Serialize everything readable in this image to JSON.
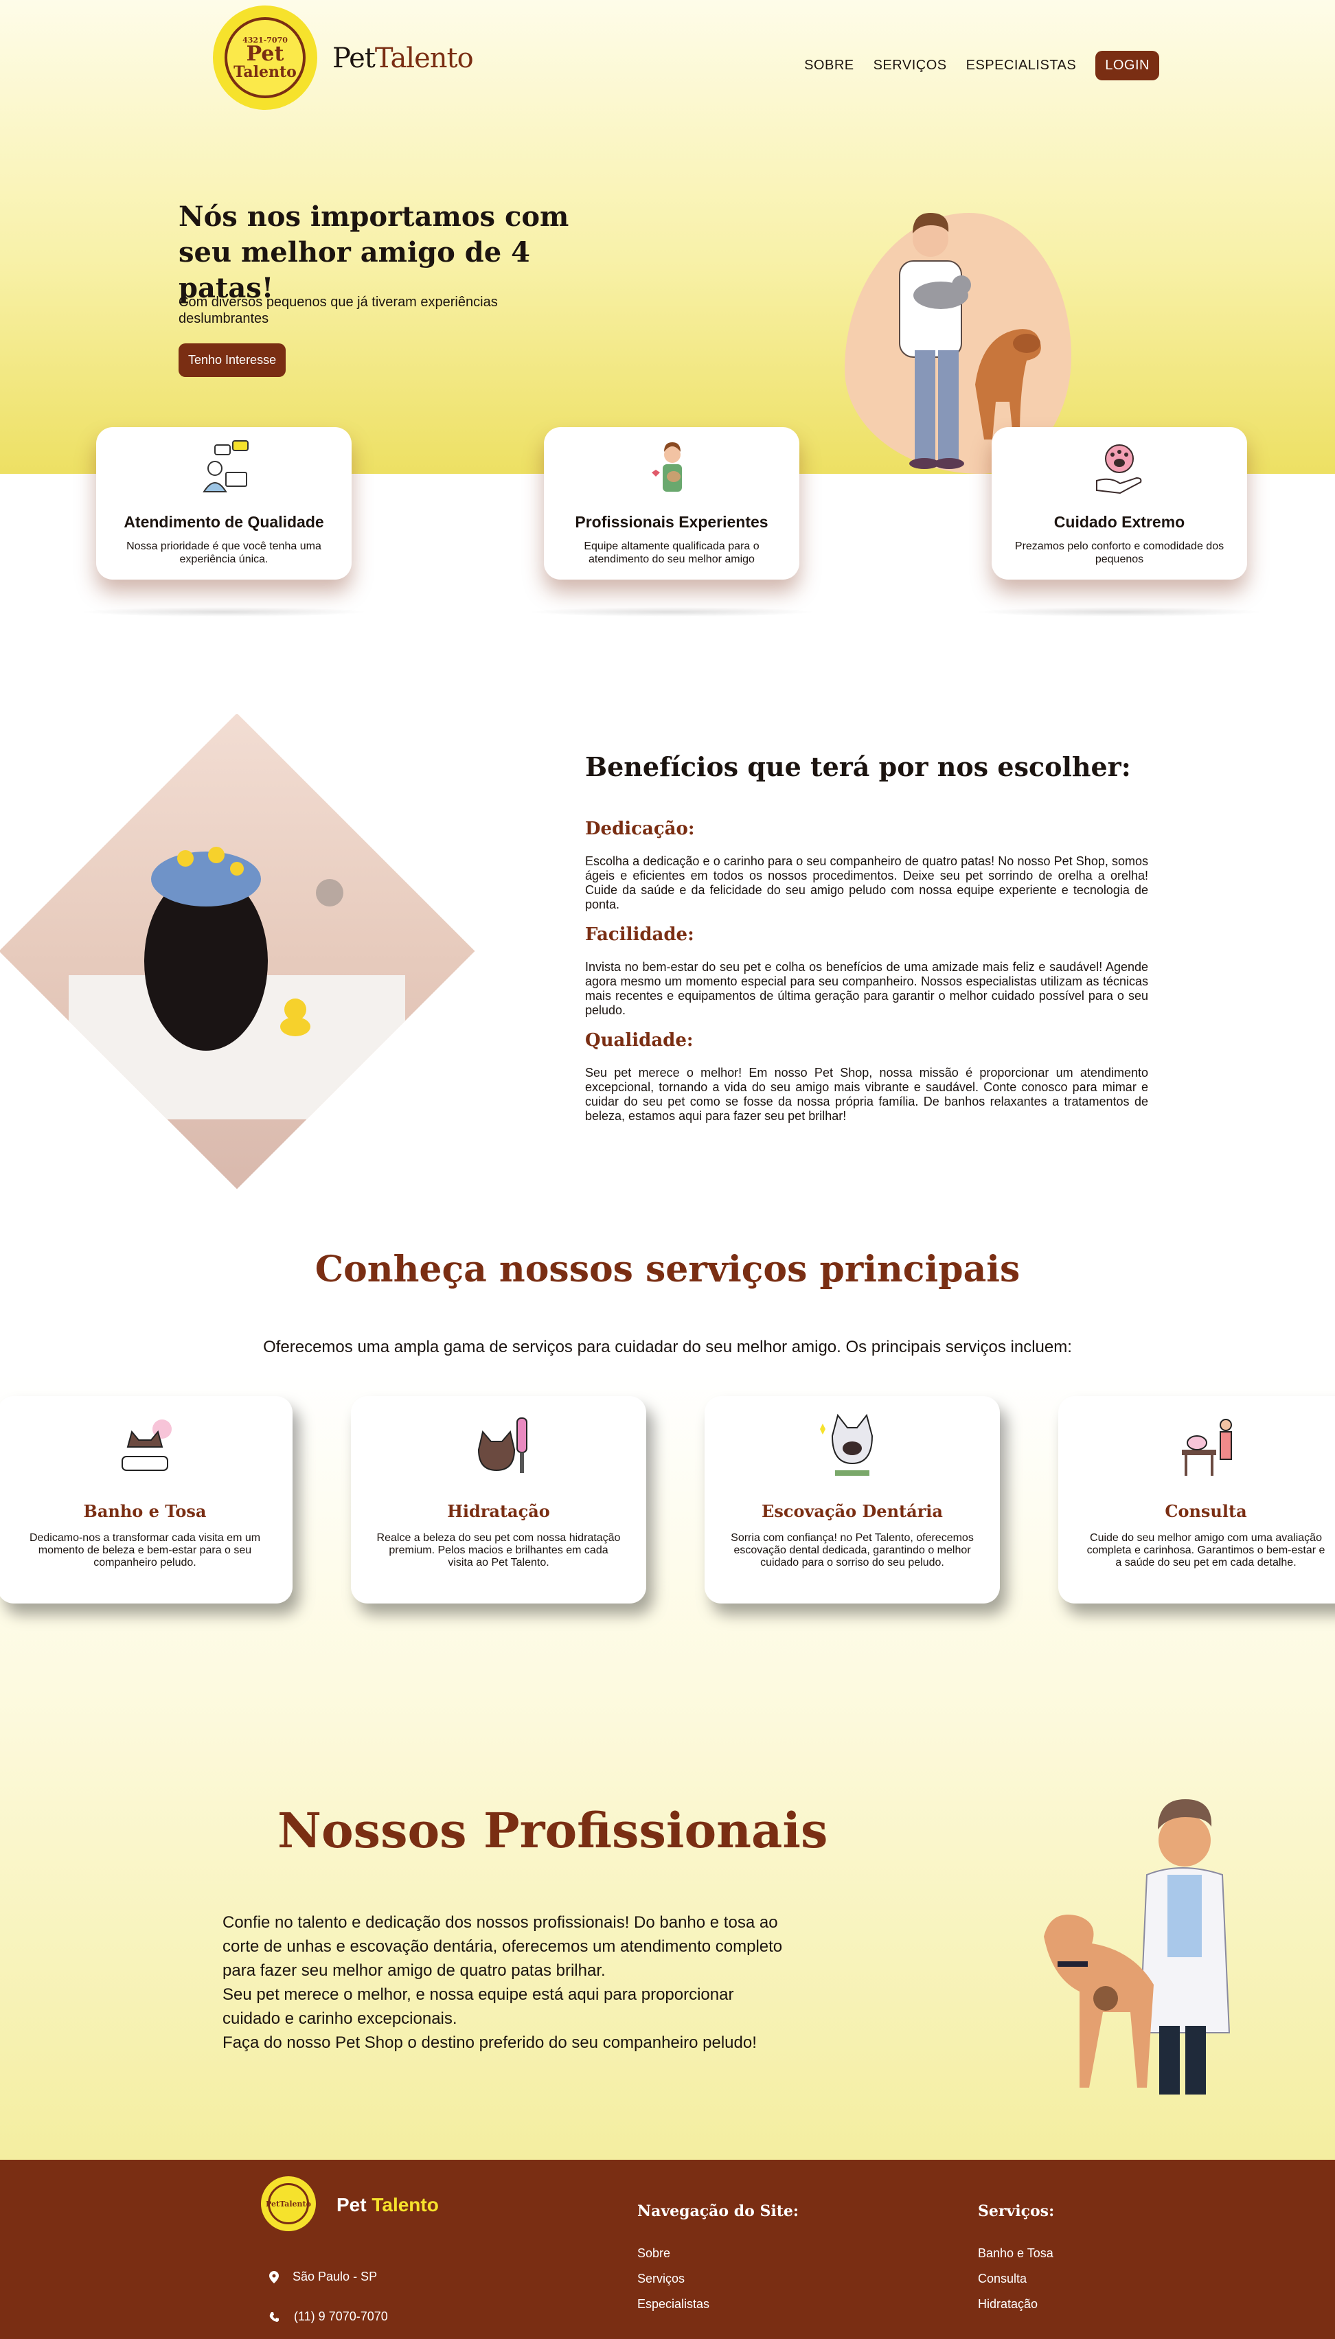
{
  "header": {
    "logo_text": [
      "4321-7070",
      "Pet",
      "Talento"
    ],
    "brand_part1": "Pet",
    "brand_part2": "Talento",
    "nav": [
      "SOBRE",
      "SERVIÇOS",
      "ESPECIALISTAS"
    ],
    "login": "LOGIN"
  },
  "hero": {
    "title": "Nós nos importamos com seu melhor amigo de 4 patas!",
    "subtitle": "Com diversos pequenos que já tiveram experiências deslumbrantes",
    "button": "Tenho Interesse"
  },
  "features": [
    {
      "title": "Atendimento de Qualidade",
      "text": "Nossa prioridade é que você tenha uma experiência única.",
      "icon": "support-agent-icon"
    },
    {
      "title": "Profissionais Experientes",
      "text": "Equipe altamente qualificada para o atendimento do seu melhor amigo",
      "icon": "pet-caretaker-icon"
    },
    {
      "title": "Cuidado Extremo",
      "text": "Prezamos pelo conforto e comodidade dos pequenos",
      "icon": "paw-hand-icon"
    }
  ],
  "benefits": {
    "title": "Benefícios que terá por nos escolher:",
    "items": [
      {
        "heading": "Dedicação:",
        "text": "Escolha a dedicação e o carinho para o seu companheiro de quatro patas! No nosso Pet Shop, somos ágeis e eficientes em todos os nossos procedimentos. Deixe seu pet sorrindo de orelha a orelha! Cuide da saúde e da felicidade do seu amigo peludo com nossa equipe experiente e tecnologia de ponta."
      },
      {
        "heading": "Facilidade:",
        "text": "Invista no bem-estar do seu pet e colha os benefícios de uma amizade mais feliz e saudável! Agende agora mesmo um momento especial para seu companheiro. Nossos especialistas utilizam as técnicas mais recentes e equipamentos de última geração para garantir o melhor cuidado possível para o seu peludo."
      },
      {
        "heading": "Qualidade:",
        "text": "Seu pet merece o melhor! Em nosso Pet Shop, nossa missão é proporcionar um atendimento excepcional, tornando a vida do seu amigo mais vibrante e saudável. Conte conosco para mimar e cuidar do seu pet como se fosse da nossa própria família. De banhos relaxantes a tratamentos de beleza, estamos aqui para fazer seu pet brilhar!"
      }
    ]
  },
  "services": {
    "title": "Conheça nossos serviços principais",
    "subtitle": "Oferecemos uma ampla gama de serviços para cuidadar do seu melhor amigo. Os principais serviços incluem:",
    "cards": [
      {
        "title": "Banho e Tosa",
        "text": "Dedicamo-nos a transformar cada visita em um momento de beleza e bem-estar para o seu companheiro peludo."
      },
      {
        "title": "Hidratação",
        "text": "Realce a beleza do seu pet com nossa hidratação premium. Pelos macios e brilhantes em cada visita ao Pet Talento."
      },
      {
        "title": "Escovação Dentária",
        "text": "Sorria com confiança! no Pet Talento, oferecemos escovação dental dedicada, garantindo o melhor cuidado para o sorriso do seu peludo."
      },
      {
        "title": "Consulta",
        "text": "Cuide do seu melhor amigo com uma avaliação completa e carinhosa. Garantimos o bem-estar e a saúde do seu pet em cada detalhe."
      }
    ]
  },
  "professionals": {
    "title": "Nossos Profissionais",
    "lines": [
      "Confie no talento e dedicação dos nossos profissionais! Do banho e tosa ao corte de unhas e escovação dentária, oferecemos um atendimento completo para fazer seu melhor amigo de quatro patas brilhar.",
      "Seu pet merece o melhor, e nossa equipe está aqui para proporcionar cuidado e carinho excepcionais.",
      "Faça do nosso Pet Shop o destino preferido do seu companheiro peludo!"
    ]
  },
  "footer": {
    "brand_part1": "Pet",
    "brand_part2": "Talento",
    "logo_text": [
      "Pet",
      "Talento"
    ],
    "location": "São Paulo - SP",
    "phone": "(11) 9 7070-7070",
    "nav_heading": "Navegação do Site:",
    "nav_links": [
      "Sobre",
      "Serviços",
      "Especialistas"
    ],
    "services_heading": "Serviços:",
    "service_links": [
      "Banho e Tosa",
      "Consulta",
      "Hidratação"
    ]
  },
  "colors": {
    "brand_brown": "#7a2e13",
    "brand_yellow": "#f6e22c",
    "hero_yellow": "#ede063"
  }
}
